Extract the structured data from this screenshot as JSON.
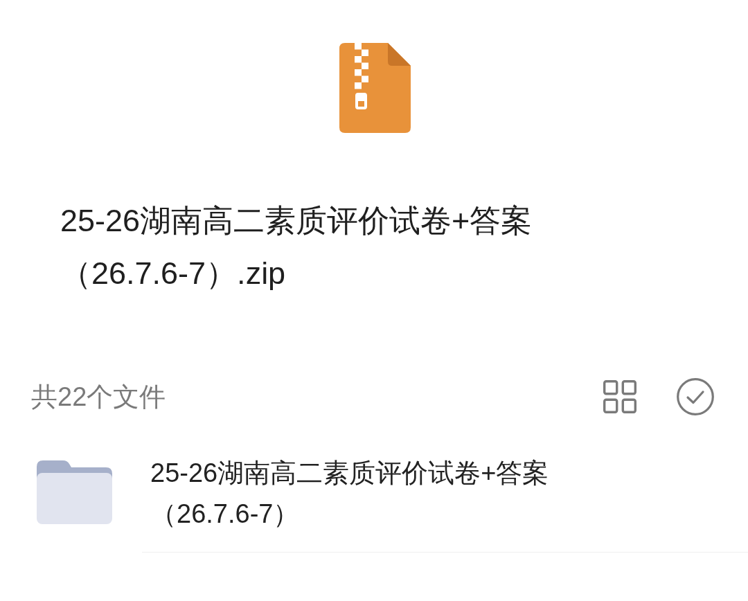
{
  "file": {
    "kind": "zip",
    "name": "25-26湖南高二素质评价试卷+答案（26.7.6-7）.zip"
  },
  "list_header": {
    "count": "共22个文件"
  },
  "items": [
    {
      "kind": "folder",
      "name": "25-26湖南高二素质评价试卷+答案（26.7.6-7）"
    }
  ]
}
